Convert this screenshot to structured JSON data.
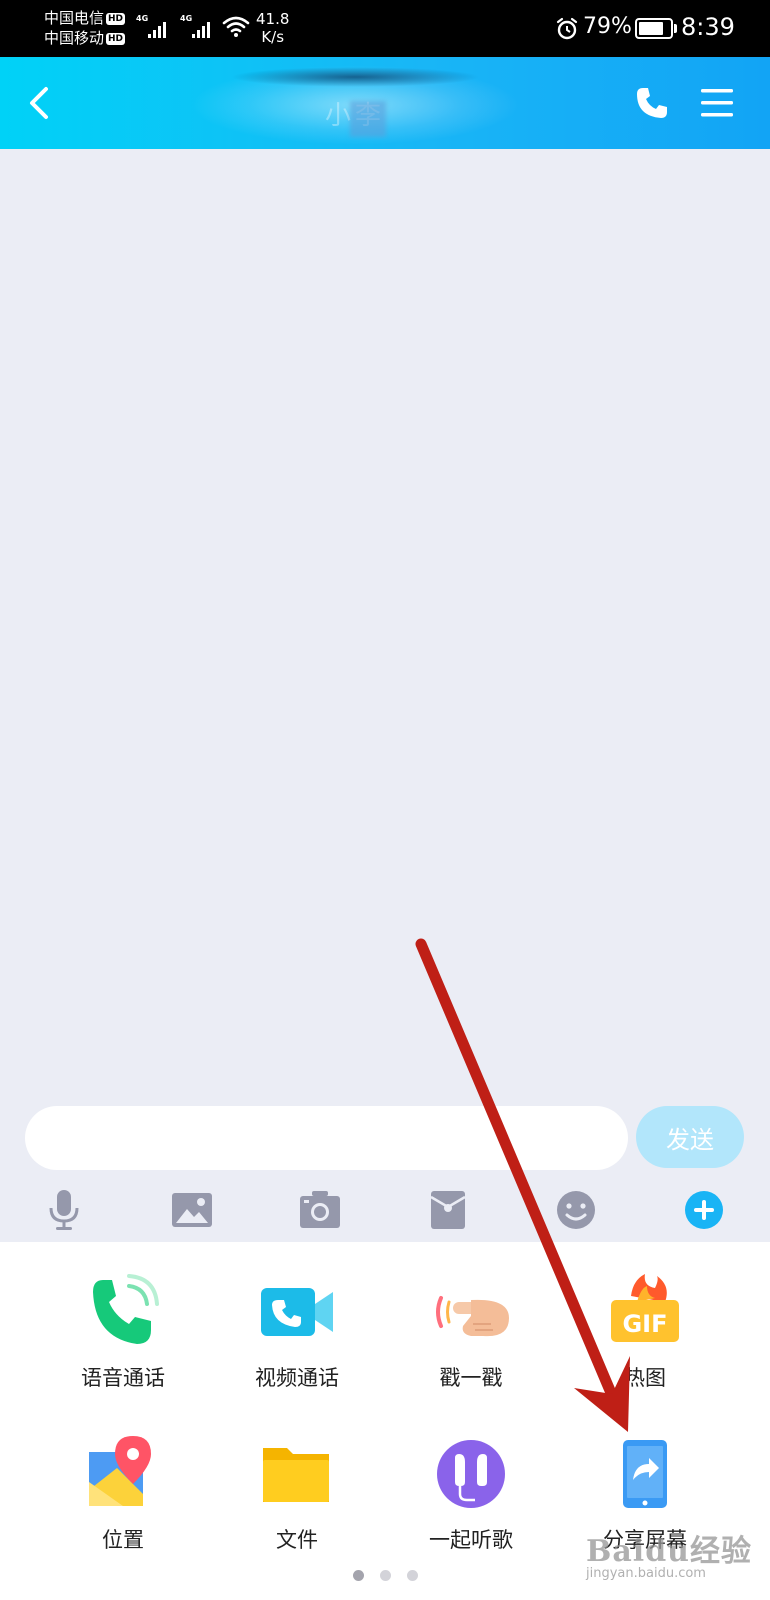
{
  "status_bar": {
    "carrier1": "中国电信",
    "carrier2": "中国移动",
    "hd_badge": "HD",
    "network_type": "4G",
    "net_speed_value": "41.8",
    "net_speed_unit": "K/s",
    "battery_percent": "79%",
    "battery_level": 0.79,
    "time": "8:39"
  },
  "header": {
    "title": "小李"
  },
  "composer": {
    "message_placeholder": "",
    "send_label": "发送"
  },
  "toolbar": {
    "icons": [
      "microphone-icon",
      "image-icon",
      "camera-icon",
      "red-packet-icon",
      "emoji-icon",
      "plus-icon"
    ]
  },
  "panel": {
    "items": [
      {
        "label": "语音通话",
        "icon": "voice-call-icon"
      },
      {
        "label": "视频通话",
        "icon": "video-call-icon"
      },
      {
        "label": "戳一戳",
        "icon": "poke-icon"
      },
      {
        "label": "热图",
        "icon": "gif-icon",
        "icon_text": "GIF"
      },
      {
        "label": "位置",
        "icon": "location-icon"
      },
      {
        "label": "文件",
        "icon": "folder-icon"
      },
      {
        "label": "一起听歌",
        "icon": "headphones-icon"
      },
      {
        "label": "分享屏幕",
        "icon": "share-screen-icon"
      }
    ],
    "page_count": 3,
    "current_page": 1
  },
  "watermark": {
    "line1": "Baidu经验",
    "line2": "jingyan.baidu.com"
  },
  "colors": {
    "header_start": "#00d2f7",
    "header_end": "#12a4f5",
    "accent": "#1ab4f5",
    "send_disabled": "#b2e6fb",
    "arrow": "#bf1f16"
  }
}
